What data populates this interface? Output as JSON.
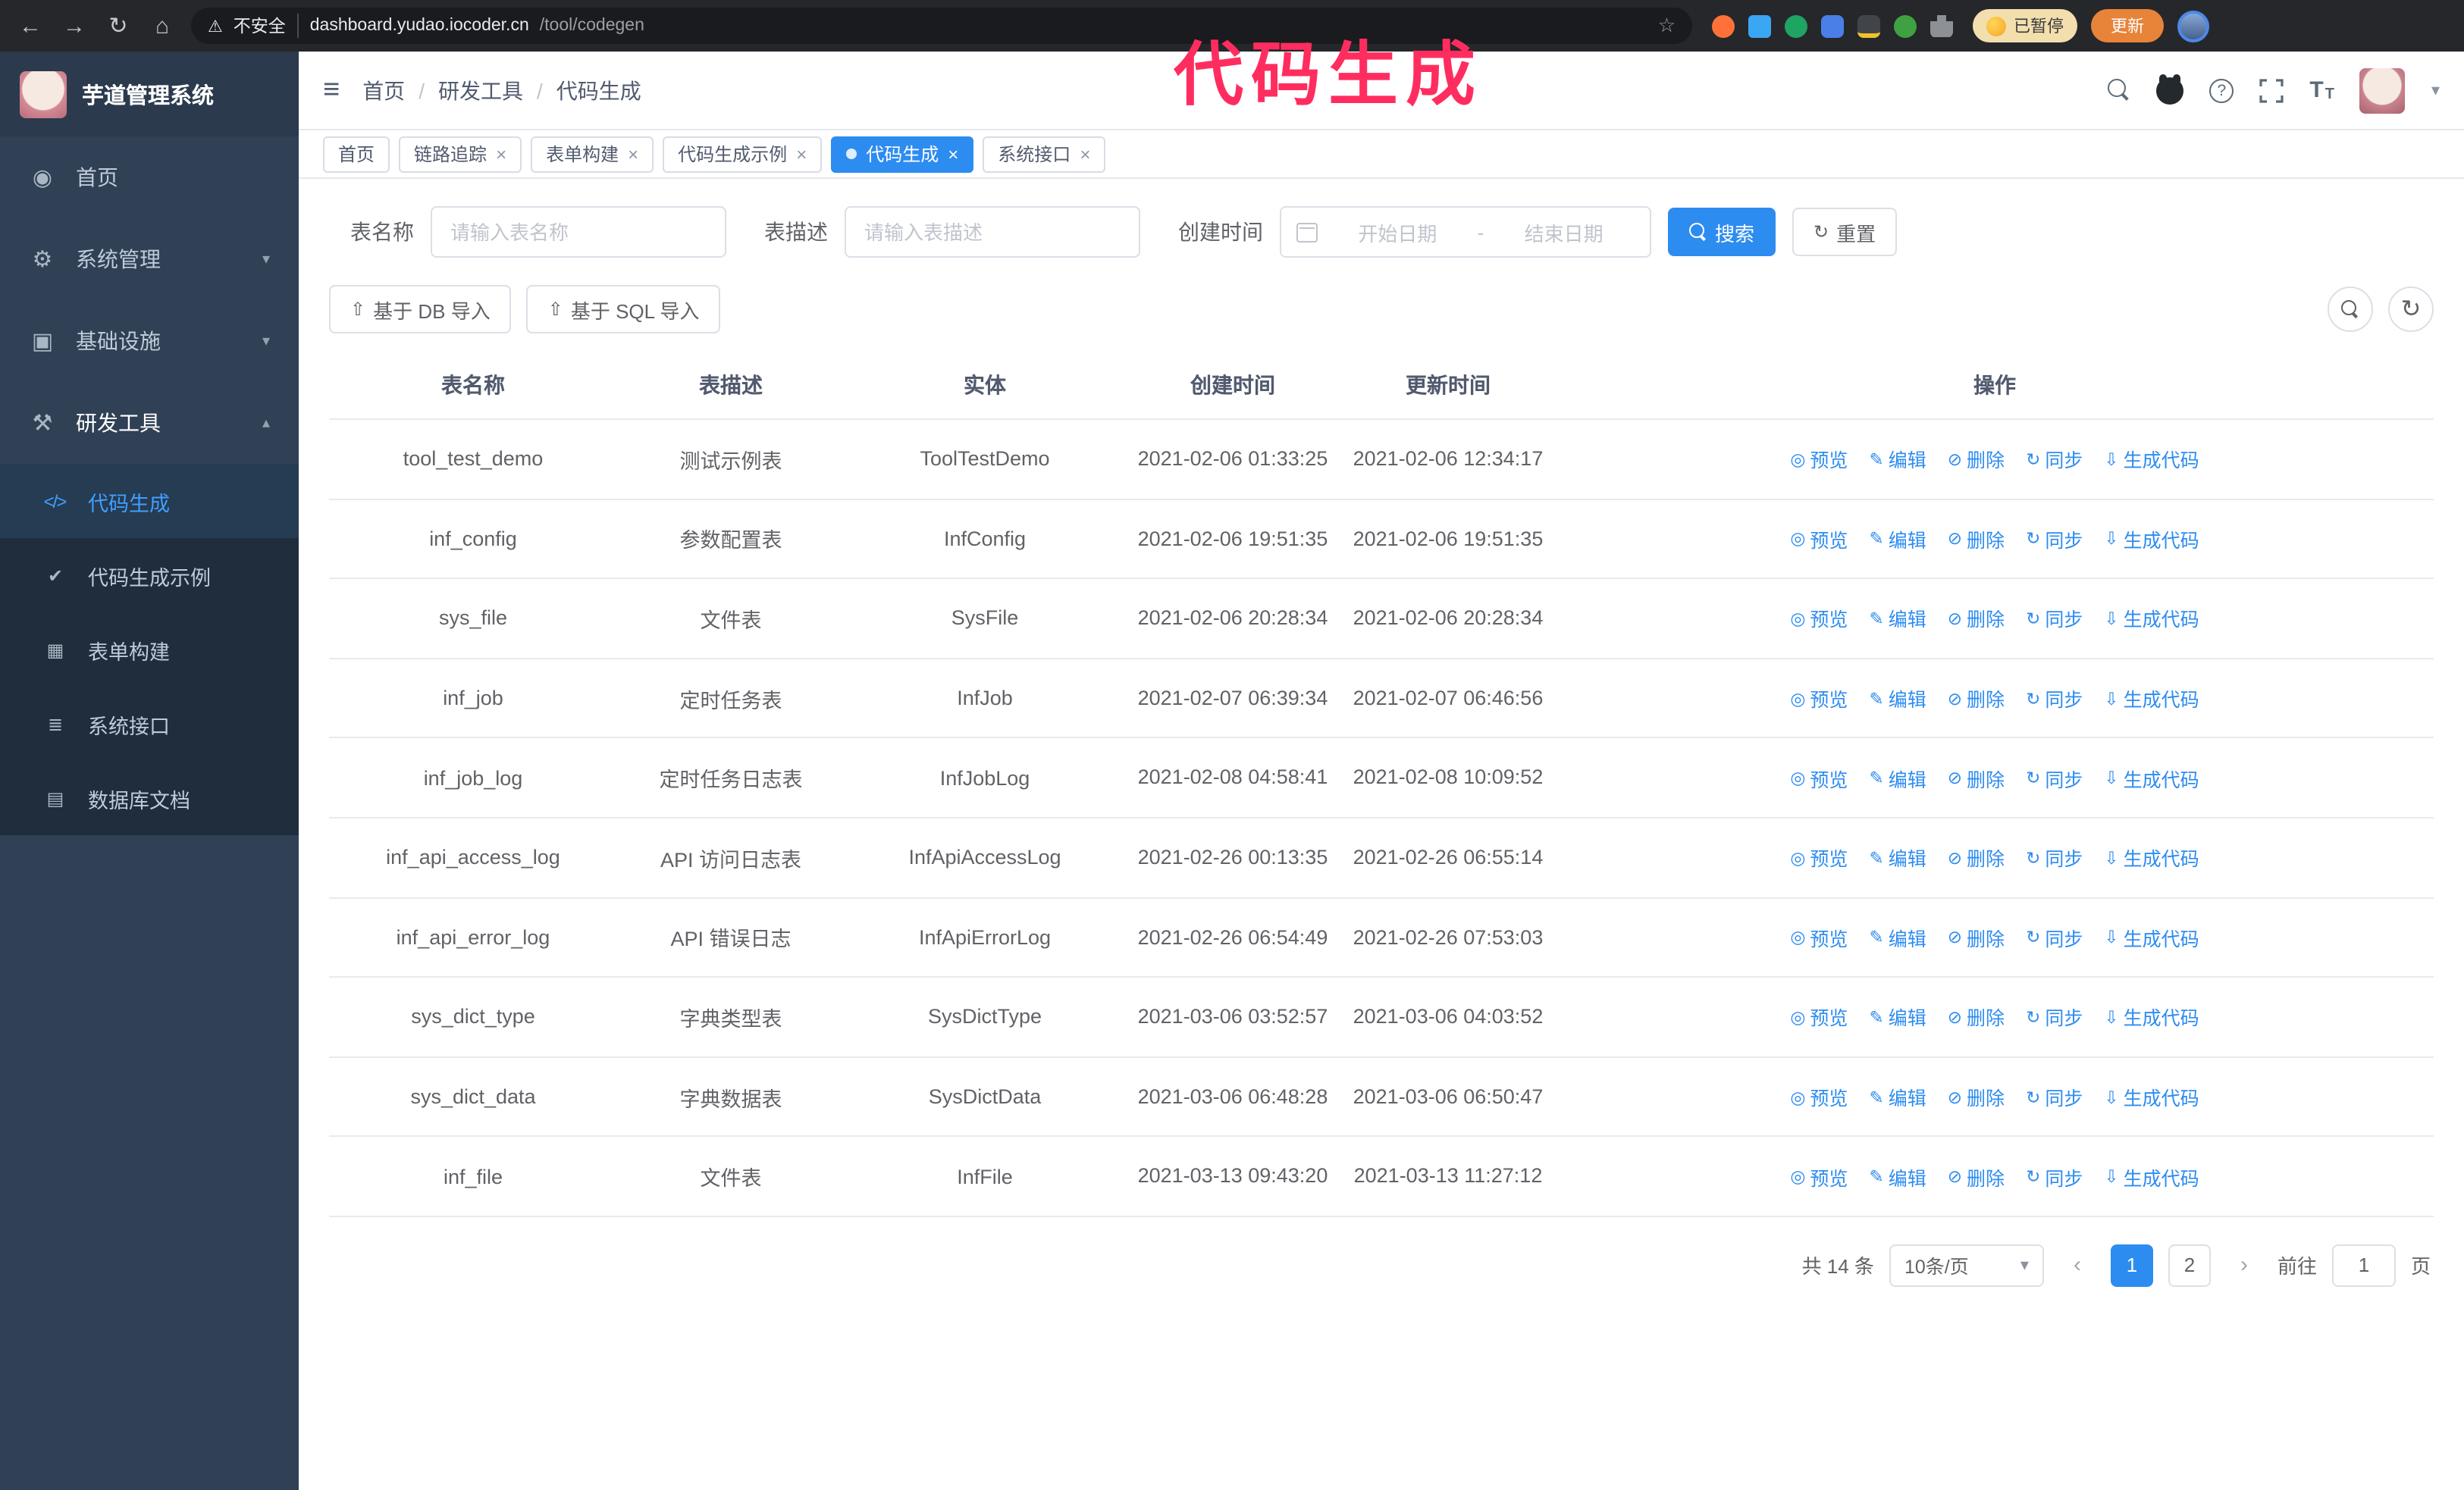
{
  "colors": {
    "accent": "#2d8cf0",
    "annotation": "#ff2d5f",
    "sidebar_bg": "#304156",
    "submenu_bg": "#1f2d3d",
    "chrome_bg": "#26272b",
    "update_btn": "#e8833a",
    "paused_bg": "#f3dfae"
  },
  "icons": {
    "back": "←",
    "forward": "→",
    "reload": "↻",
    "home": "⌂",
    "warning": "⚠",
    "star": "☆",
    "hamburger": "≡",
    "caret_down": "▾",
    "chevron_down": "▾",
    "chevron_up": "▴",
    "menu_home": "◉",
    "menu_system": "⚙",
    "menu_infra": "▣",
    "menu_dev": "⚒",
    "sub_codegen": "</>",
    "sub_example": "✔",
    "sub_form": "▦",
    "sub_api": "≣",
    "sub_db": "▤",
    "close": "×",
    "question": "?",
    "font_size": "T",
    "upload": "⇧",
    "eye": "◎",
    "edit": "✎",
    "delete": "⊘",
    "sync": "↻",
    "download": "⇩",
    "prev": "‹",
    "next": "›"
  },
  "browser": {
    "security_label": "不安全",
    "url_host": "dashboard.yudao.iocoder.cn",
    "url_path": "/tool/codegen",
    "paused_badge": "已暂停",
    "update_button": "更新"
  },
  "annotation": {
    "text": "代码生成"
  },
  "sidebar": {
    "logo_title": "芋道管理系统",
    "items": [
      {
        "label": "首页"
      },
      {
        "label": "系统管理"
      },
      {
        "label": "基础设施"
      },
      {
        "label": "研发工具"
      }
    ],
    "sub_items": [
      {
        "label": "代码生成"
      },
      {
        "label": "代码生成示例"
      },
      {
        "label": "表单构建"
      },
      {
        "label": "系统接口"
      },
      {
        "label": "数据库文档"
      }
    ]
  },
  "header": {
    "breadcrumb": [
      "首页",
      "研发工具",
      "代码生成"
    ]
  },
  "tabs": [
    {
      "label": "首页"
    },
    {
      "label": "链路追踪"
    },
    {
      "label": "表单构建"
    },
    {
      "label": "代码生成示例"
    },
    {
      "label": "代码生成",
      "active": true
    },
    {
      "label": "系统接口"
    }
  ],
  "filters": {
    "table_name_label": "表名称",
    "table_name_placeholder": "请输入表名称",
    "table_desc_label": "表描述",
    "table_desc_placeholder": "请输入表描述",
    "create_time_label": "创建时间",
    "date_start_placeholder": "开始日期",
    "date_separator": "-",
    "date_end_placeholder": "结束日期",
    "search_button": "搜索",
    "reset_button": "重置"
  },
  "toolbar": {
    "import_db_button": "基于 DB 导入",
    "import_sql_button": "基于 SQL 导入"
  },
  "table": {
    "columns": [
      "表名称",
      "表描述",
      "实体",
      "创建时间",
      "更新时间",
      "操作"
    ],
    "actions": [
      "预览",
      "编辑",
      "删除",
      "同步",
      "生成代码"
    ],
    "rows": [
      {
        "name": "tool_test_demo",
        "desc": "测试示例表",
        "entity": "ToolTestDemo",
        "created": "2021-02-06 01:33:25",
        "updated": "2021-02-06 12:34:17"
      },
      {
        "name": "inf_config",
        "desc": "参数配置表",
        "entity": "InfConfig",
        "created": "2021-02-06 19:51:35",
        "updated": "2021-02-06 19:51:35"
      },
      {
        "name": "sys_file",
        "desc": "文件表",
        "entity": "SysFile",
        "created": "2021-02-06 20:28:34",
        "updated": "2021-02-06 20:28:34"
      },
      {
        "name": "inf_job",
        "desc": "定时任务表",
        "entity": "InfJob",
        "created": "2021-02-07 06:39:34",
        "updated": "2021-02-07 06:46:56"
      },
      {
        "name": "inf_job_log",
        "desc": "定时任务日志表",
        "entity": "InfJobLog",
        "created": "2021-02-08 04:58:41",
        "updated": "2021-02-08 10:09:52"
      },
      {
        "name": "inf_api_access_log",
        "desc": "API 访问日志表",
        "entity": "InfApiAccessLog",
        "created": "2021-02-26 00:13:35",
        "updated": "2021-02-26 06:55:14"
      },
      {
        "name": "inf_api_error_log",
        "desc": "API 错误日志",
        "entity": "InfApiErrorLog",
        "created": "2021-02-26 06:54:49",
        "updated": "2021-02-26 07:53:03"
      },
      {
        "name": "sys_dict_type",
        "desc": "字典类型表",
        "entity": "SysDictType",
        "created": "2021-03-06 03:52:57",
        "updated": "2021-03-06 04:03:52"
      },
      {
        "name": "sys_dict_data",
        "desc": "字典数据表",
        "entity": "SysDictData",
        "created": "2021-03-06 06:48:28",
        "updated": "2021-03-06 06:50:47"
      },
      {
        "name": "inf_file",
        "desc": "文件表",
        "entity": "InfFile",
        "created": "2021-03-13 09:43:20",
        "updated": "2021-03-13 11:27:12"
      }
    ]
  },
  "pagination": {
    "total_text": "共 14 条",
    "page_size": "10条/页",
    "pages": [
      "1",
      "2"
    ],
    "goto_label": "前往",
    "goto_value": "1",
    "goto_suffix": "页"
  }
}
